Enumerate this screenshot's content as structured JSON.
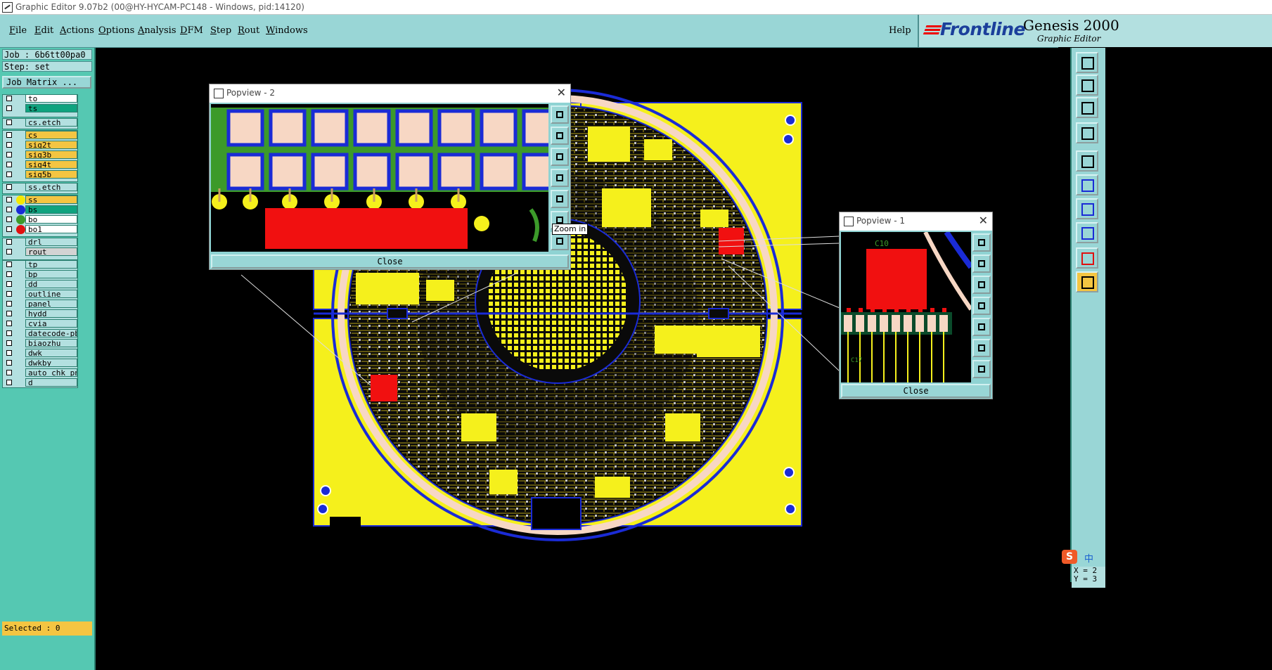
{
  "window": {
    "title": "Graphic Editor 9.07b2 (00@HY-HYCAM-PC148 - Windows, pid:14120)"
  },
  "menu": {
    "items": [
      {
        "label": "File",
        "u": "F",
        "rest": "ile"
      },
      {
        "label": "Edit",
        "u": "E",
        "rest": "dit"
      },
      {
        "label": "Actions",
        "u": "A",
        "rest": "ctions"
      },
      {
        "label": "Options",
        "u": "O",
        "rest": "ptions"
      },
      {
        "label": "Analysis",
        "u": "A",
        "rest": "nalysis"
      },
      {
        "label": "DFM",
        "u": "D",
        "rest": "FM"
      },
      {
        "label": "Step",
        "u": "S",
        "rest": "tep"
      },
      {
        "label": "Rout",
        "u": "R",
        "rest": "out"
      },
      {
        "label": "Windows",
        "u": "W",
        "rest": "indows"
      }
    ],
    "help": "Help"
  },
  "brand": {
    "logo": "Frontline",
    "product": "Genesis 2000",
    "subtitle": "Graphic Editor"
  },
  "job": {
    "job_line": "Job : 6b6tt00pa0",
    "step_line": "Step: set",
    "matrix_button": "Job Matrix ..."
  },
  "layers": [
    {
      "name": "to",
      "bg": "#ffffff",
      "dot": ""
    },
    {
      "name": "ts",
      "bg": "#0fa37f",
      "dot": ""
    },
    {
      "name": "cs.etch",
      "bg": "#b3e0e0",
      "dot": ""
    },
    {
      "name": "cs",
      "bg": "#f4c542",
      "dot": ""
    },
    {
      "name": "sig2t",
      "bg": "#f4c542",
      "dot": ""
    },
    {
      "name": "sig3b",
      "bg": "#f4c542",
      "dot": ""
    },
    {
      "name": "sig4t",
      "bg": "#f4c542",
      "dot": ""
    },
    {
      "name": "sig5b",
      "bg": "#f4c542",
      "dot": ""
    },
    {
      "name": "ss.etch",
      "bg": "#b3e0e0",
      "dot": ""
    },
    {
      "name": "ss",
      "bg": "#f4c542",
      "dot": "#f5e800"
    },
    {
      "name": "bs",
      "bg": "#0fa37f",
      "dot": "#1a2bd6"
    },
    {
      "name": "bo",
      "bg": "#ffffff",
      "dot": "#3c9a2a"
    },
    {
      "name": "bo1",
      "bg": "#ffffff",
      "dot": "#e01010"
    },
    {
      "name": "drl",
      "bg": "#b3e0e0",
      "dot": ""
    },
    {
      "name": "rout",
      "bg": "#d3d3d3",
      "dot": ""
    },
    {
      "name": "tp",
      "bg": "#b3e0e0",
      "dot": ""
    },
    {
      "name": "bp",
      "bg": "#b3e0e0",
      "dot": ""
    },
    {
      "name": "dd",
      "bg": "#b3e0e0",
      "dot": ""
    },
    {
      "name": "outline",
      "bg": "#b3e0e0",
      "dot": ""
    },
    {
      "name": "panel",
      "bg": "#b3e0e0",
      "dot": ""
    },
    {
      "name": "hydd",
      "bg": "#b3e0e0",
      "dot": ""
    },
    {
      "name": "cvia",
      "bg": "#b3e0e0",
      "dot": ""
    },
    {
      "name": "datecode-pbe",
      "bg": "#b3e0e0",
      "dot": ""
    },
    {
      "name": "biaozhu",
      "bg": "#b3e0e0",
      "dot": ""
    },
    {
      "name": "dwk",
      "bg": "#b3e0e0",
      "dot": ""
    },
    {
      "name": "dwkby",
      "bg": "#b3e0e0",
      "dot": ""
    },
    {
      "name": "auto_chk_pnl",
      "bg": "#b3e0e0",
      "dot": ""
    },
    {
      "name": "d",
      "bg": "#b3e0e0",
      "dot": ""
    }
  ],
  "selected": "Selected : 0",
  "popview2": {
    "title": "Popview - 2",
    "close_label": "Close",
    "tooltip": "Zoom in"
  },
  "popview1": {
    "title": "Popview - 1",
    "close_label": "Close",
    "labels": [
      "C10",
      "C17"
    ]
  },
  "ime": {
    "logo": "S",
    "text": "中"
  },
  "coords": {
    "x": "X = 2",
    "y": "Y = 3"
  },
  "colors": {
    "board": "#f5f01c",
    "outline": "#1a2bd6",
    "pad": "#f7d7c4",
    "mask": "#0a0a0a",
    "red": "#f11010",
    "green": "#3c9a2a"
  }
}
